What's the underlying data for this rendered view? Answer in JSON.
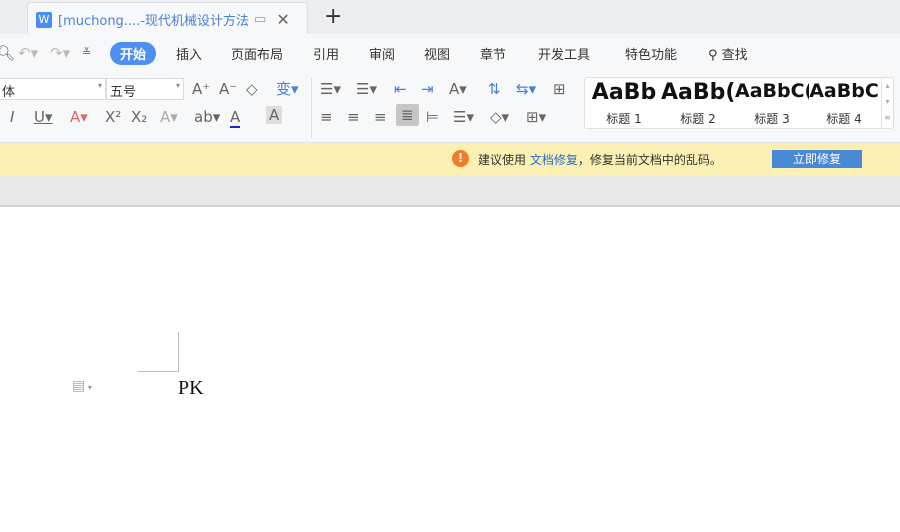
{
  "tab": {
    "title": "[muchong....-现代机械设计方法",
    "new_tab": "+"
  },
  "menu": [
    "开始",
    "插入",
    "页面布局",
    "引用",
    "审阅",
    "视图",
    "章节",
    "开发工具",
    "特色功能",
    "查找"
  ],
  "font": {
    "name": "体",
    "size": "五号"
  },
  "styles": [
    {
      "preview": "AaBb",
      "label": "标题 1"
    },
    {
      "preview": "AaBb(",
      "label": "标题 2"
    },
    {
      "preview": "AaBbC(",
      "label": "标题 3"
    },
    {
      "preview": "AaBbC",
      "label": "标题 4"
    }
  ],
  "notice": {
    "prefix": "建议使用",
    "link": "文档修复",
    "suffix": "，修复当前文档中的乱码。",
    "button": "立即修复"
  },
  "document": {
    "text": "PK"
  }
}
